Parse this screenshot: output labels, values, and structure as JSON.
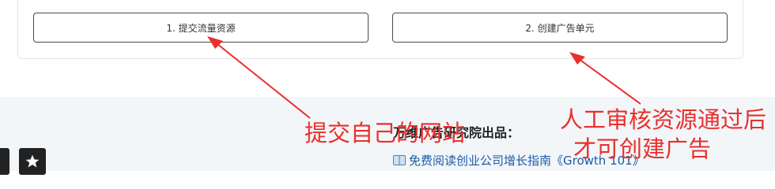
{
  "buttons": {
    "submit_traffic": "1. 提交流量资源",
    "create_ad_unit": "2. 创建广告单元"
  },
  "footer": {
    "heading": "万维广告研究院出品：",
    "link_text": "免费阅读创业公司增长指南《Growth 101》"
  },
  "annotations": {
    "left": "提交自己的网站",
    "right_line1": "人工审核资源通过后",
    "right_line2": "才可创建广告"
  },
  "colors": {
    "annotation": "#e8302c",
    "link": "#1a5ca8",
    "footer_bg": "#f3f6f9"
  },
  "icons": {
    "book": "book-icon",
    "star": "star-icon"
  }
}
